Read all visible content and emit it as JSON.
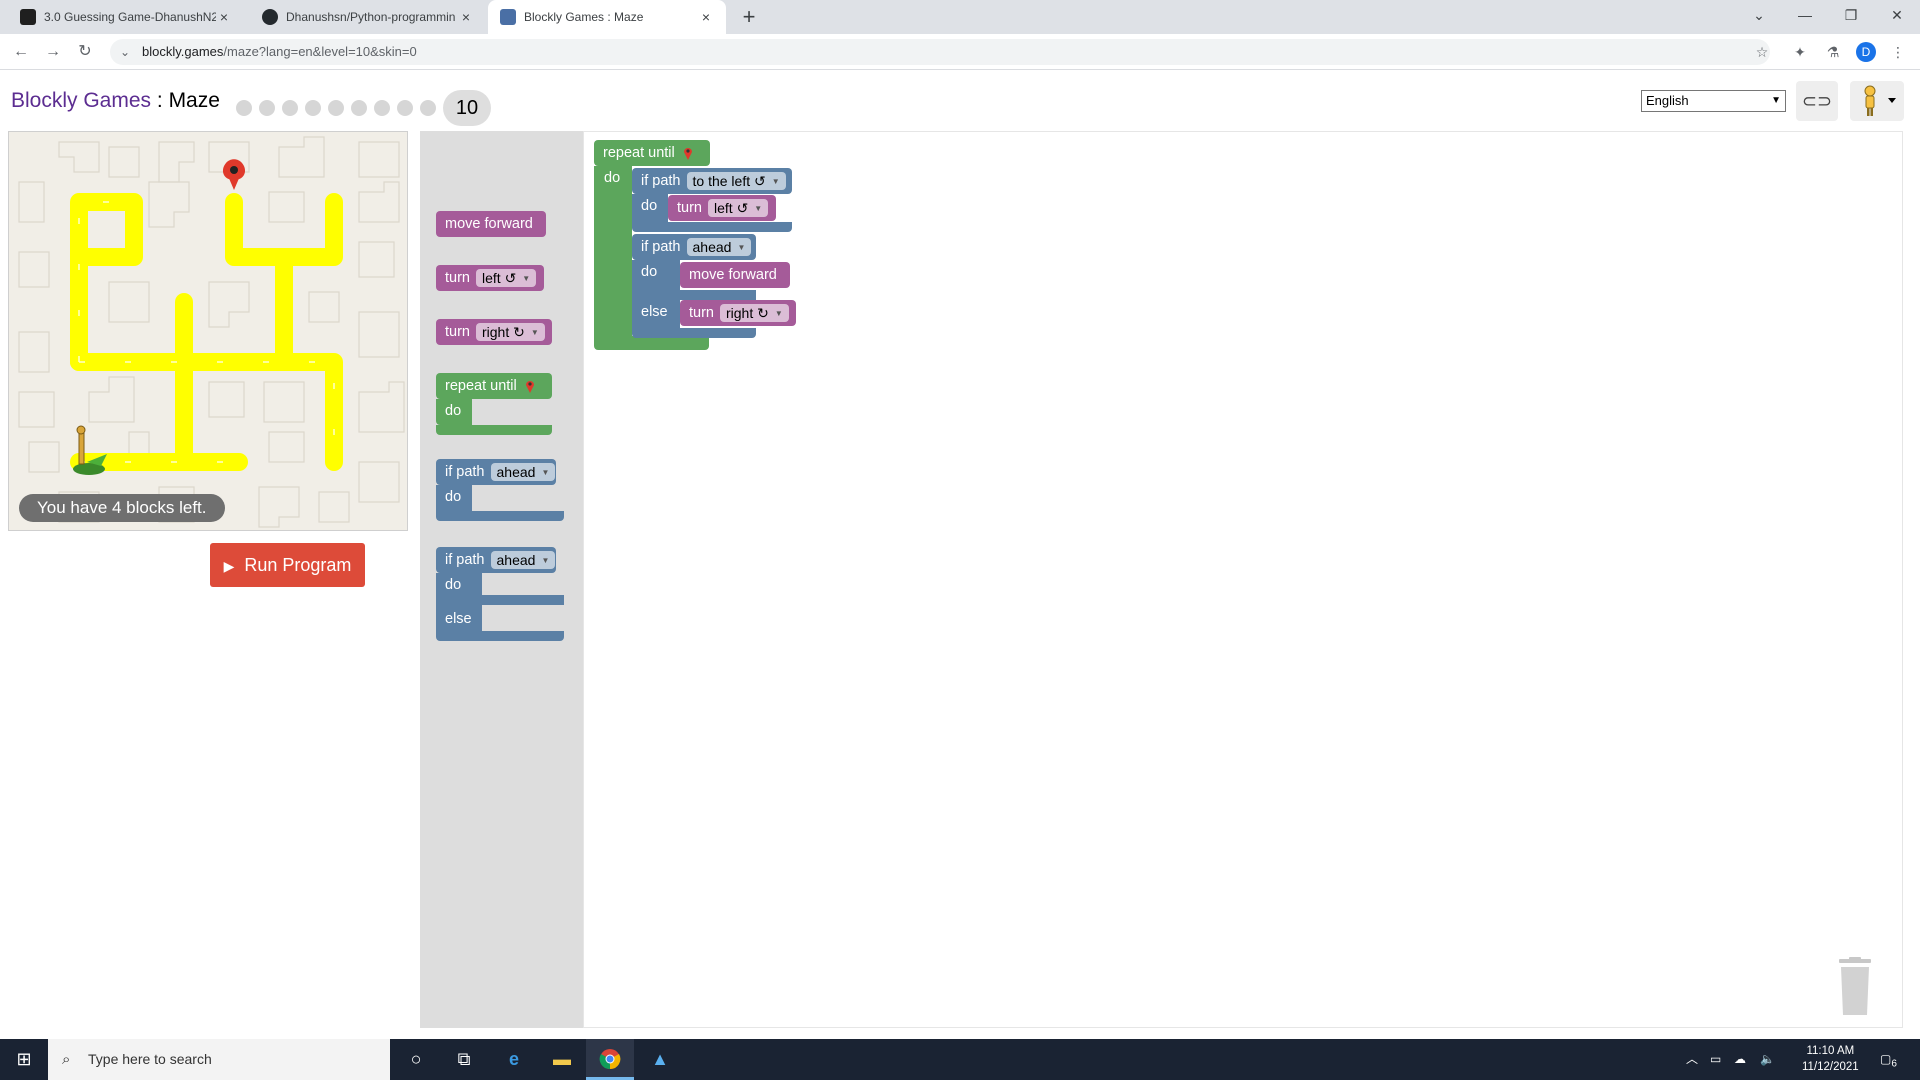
{
  "browser": {
    "tabs": [
      {
        "title": "3.0 Guessing Game-DhanushN2"
      },
      {
        "title": "Dhanushsn/Python-programmin"
      },
      {
        "title": "Blockly Games : Maze"
      }
    ],
    "close_glyph": "×",
    "newtab_glyph": "+",
    "url_domain": "blockly.games",
    "url_path": "/maze?lang=en&level=10&skin=0",
    "profile_initial": "D"
  },
  "header": {
    "brand": "Blockly Games",
    "separator": " : ",
    "game": "Maze",
    "current_level": "10",
    "language": "English"
  },
  "maze": {
    "blocks_left": "You have 4 blocks left."
  },
  "run_button": {
    "label": "Run Program"
  },
  "toolbox": {
    "move_forward": "move forward",
    "turn1": {
      "label": "turn",
      "dir": "left ↺"
    },
    "turn2": {
      "label": "turn",
      "dir": "right ↻"
    },
    "repeat": {
      "label": "repeat until",
      "do": "do"
    },
    "ifpath1": {
      "label": "if path",
      "dir": "ahead",
      "do": "do"
    },
    "ifpath2": {
      "label": "if path",
      "dir": "ahead",
      "do": "do",
      "else": "else"
    }
  },
  "program": {
    "repeat": {
      "label": "repeat until",
      "do": "do"
    },
    "if1": {
      "label": "if path",
      "dir": "to the left ↺",
      "do": "do",
      "turn_label": "turn",
      "turn_dir": "left ↺"
    },
    "if2": {
      "label": "if path",
      "dir": "ahead",
      "do": "do",
      "move": "move forward",
      "else": "else",
      "turn_label": "turn",
      "turn_dir": "right ↻"
    }
  },
  "taskbar": {
    "search_placeholder": "Type here to search",
    "time": "11:10 AM",
    "date": "11/12/2021",
    "notifications": "6"
  }
}
